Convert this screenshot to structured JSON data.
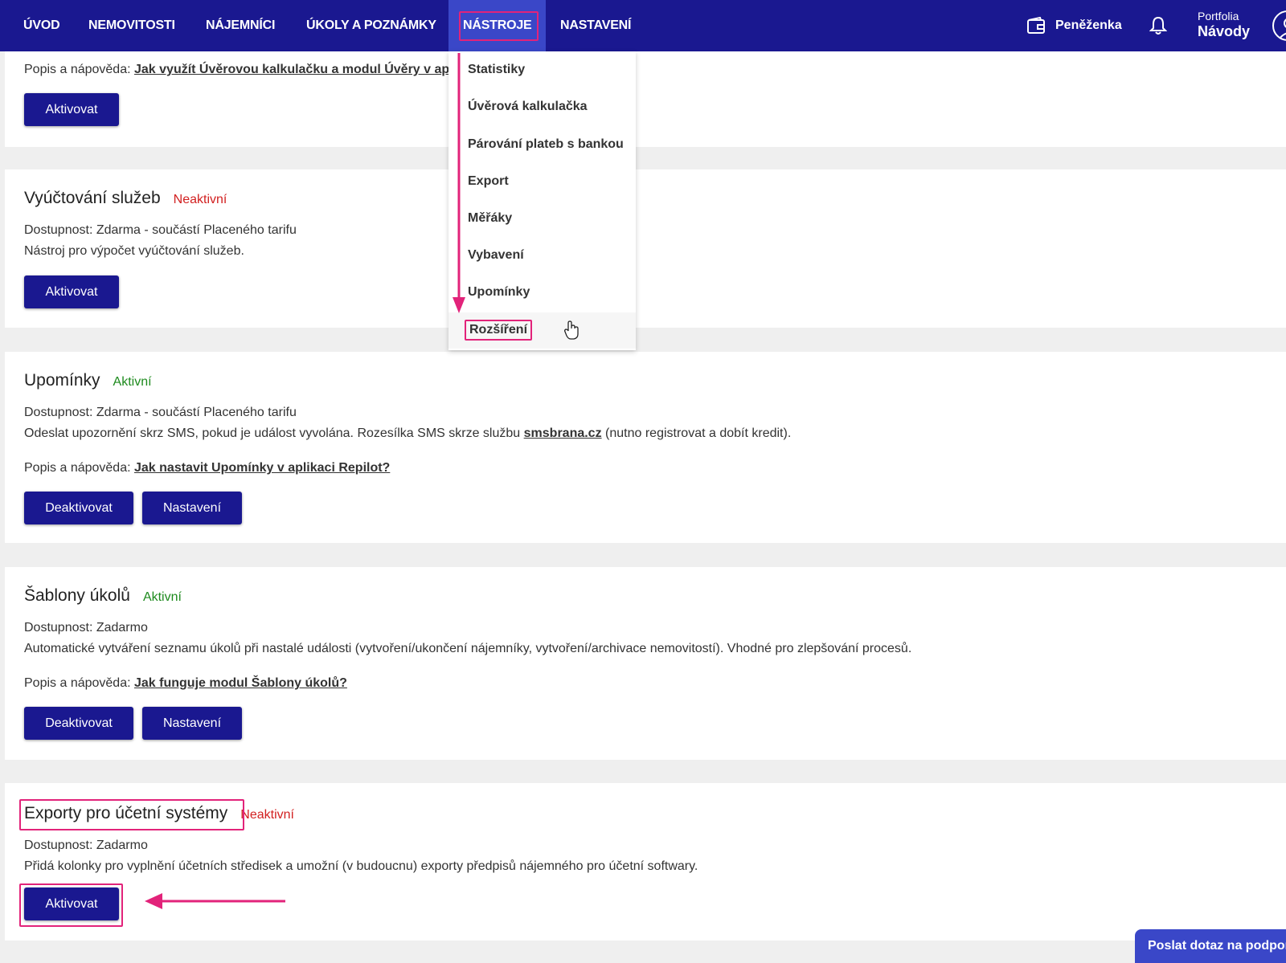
{
  "nav": {
    "items": [
      {
        "label": "ÚVOD"
      },
      {
        "label": "NEMOVITOSTI"
      },
      {
        "label": "NÁJEMNÍCI"
      },
      {
        "label": "ÚKOLY A POZNÁMKY"
      },
      {
        "label": "NÁSTROJE"
      },
      {
        "label": "NASTAVENÍ"
      }
    ],
    "wallet_label": "Peněženka",
    "portfolio_label": "Portfolia",
    "portfolio_value": "Návody"
  },
  "dropdown": {
    "items": [
      {
        "label": "Statistiky"
      },
      {
        "label": "Úvěrová kalkulačka"
      },
      {
        "label": "Párování plateb s bankou"
      },
      {
        "label": "Export"
      },
      {
        "label": "Měřáky"
      },
      {
        "label": "Vybavení"
      },
      {
        "label": "Upomínky"
      },
      {
        "label": "Rozšíření"
      }
    ]
  },
  "cards": {
    "loans": {
      "help_prefix": "Popis a nápověda:",
      "help_link": "Jak využít Úvěrovou kalkulačku a modul Úvěry v aplik",
      "button": "Aktivovat"
    },
    "billing": {
      "title": "Vyúčtování služeb",
      "status": "Neaktivní",
      "availability": "Dostupnost: Zdarma - součástí Placeného tarifu",
      "description": "Nástroj pro výpočet vyúčtování služeb.",
      "button": "Aktivovat"
    },
    "reminders": {
      "title": "Upomínky",
      "status": "Aktivní",
      "availability": "Dostupnost: Zdarma - součástí Placeného tarifu",
      "desc_before": "Odeslat upozornění skrz SMS, pokud je událost vyvolána. Rozesílka SMS skrze službu",
      "desc_link": "smsbrana.cz",
      "desc_after": "(nutno registrovat a dobít kredit).",
      "help_prefix": "Popis a nápověda:",
      "help_link": "Jak nastavit Upomínky v aplikaci Repilot?",
      "button_deactivate": "Deaktivovat",
      "button_settings": "Nastavení"
    },
    "task_templates": {
      "title": "Šablony úkolů",
      "status": "Aktivní",
      "availability": "Dostupnost: Zadarmo",
      "description": "Automatické vytváření seznamu úkolů při nastalé události (vytvoření/ukončení nájemníky, vytvoření/archivace nemovitostí). Vhodné pro zlepšování procesů.",
      "help_prefix": "Popis a nápověda:",
      "help_link": "Jak funguje modul Šablony úkolů?",
      "button_deactivate": "Deaktivovat",
      "button_settings": "Nastavení"
    },
    "accounting_exports": {
      "title": "Exporty pro účetní systémy",
      "status": "Neaktivní",
      "availability": "Dostupnost: Zadarmo",
      "description": "Přidá kolonky pro vyplnění účetních středisek a umožní (v budoucnu) exporty předpisů nájemného pro účetní softwary.",
      "button": "Aktivovat"
    }
  },
  "support_button": "Poslat dotaz na podporu",
  "colors": {
    "navbar": "#1a1890",
    "nav_active": "#3a47c8",
    "button": "#1a1890",
    "annotation": "#e2237a",
    "inactive": "#d22020",
    "active": "#1d8a1d"
  }
}
